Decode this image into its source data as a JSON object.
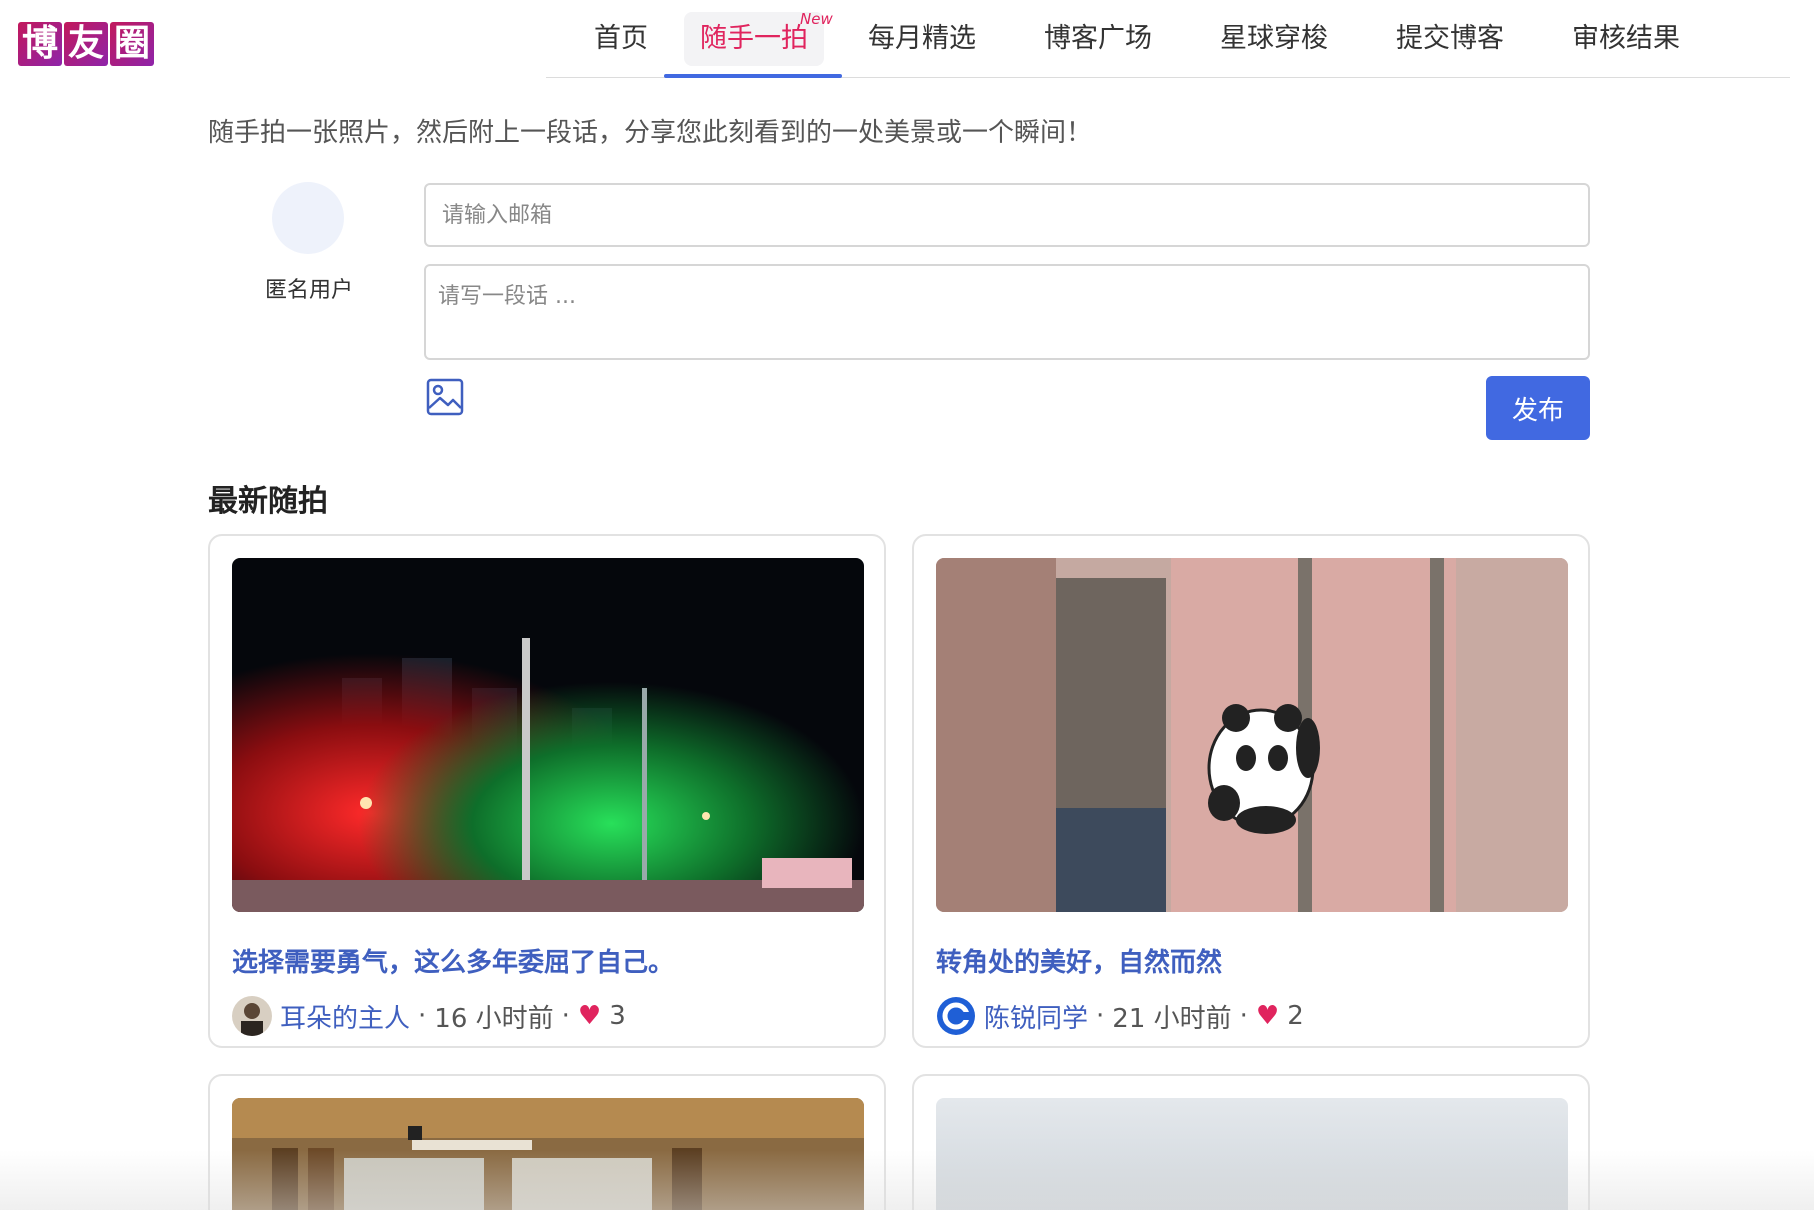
{
  "brand": {
    "logo_chars": [
      "博",
      "友",
      "圈"
    ],
    "accent": "#4169e1",
    "highlight": "#e0245e"
  },
  "nav": {
    "items": [
      {
        "label": "首页"
      },
      {
        "label": "随手一拍",
        "active": true,
        "badge": "New"
      },
      {
        "label": "每月精选"
      },
      {
        "label": "博客广场"
      },
      {
        "label": "星球穿梭"
      },
      {
        "label": "提交博客"
      },
      {
        "label": "审核结果"
      }
    ]
  },
  "intro": "随手拍一张照片，然后附上一段话，分享您此刻看到的一处美景或一个瞬间！",
  "form": {
    "user_name": "匿名用户",
    "email_placeholder": "请输入邮箱",
    "text_placeholder": "请写一段话 ...",
    "image_icon": "image-upload-icon",
    "submit_label": "发布"
  },
  "section_title": "最新随拍",
  "posts": [
    {
      "title": "选择需要勇气，这么多年委屈了自己。",
      "author": "耳朵的主人",
      "time": "16 小时前",
      "likes": "3",
      "photo": "night-street-traffic-lights"
    },
    {
      "title": "转角处的美好，自然而然",
      "author": "陈锐同学",
      "time": "21 小时前",
      "likes": "2",
      "photo": "panda-sticker-on-wall"
    },
    {
      "title": "",
      "author": "",
      "time": "",
      "likes": "",
      "photo": "classroom-window"
    },
    {
      "title": "",
      "author": "",
      "time": "",
      "likes": "",
      "photo": "foggy-sky"
    }
  ]
}
